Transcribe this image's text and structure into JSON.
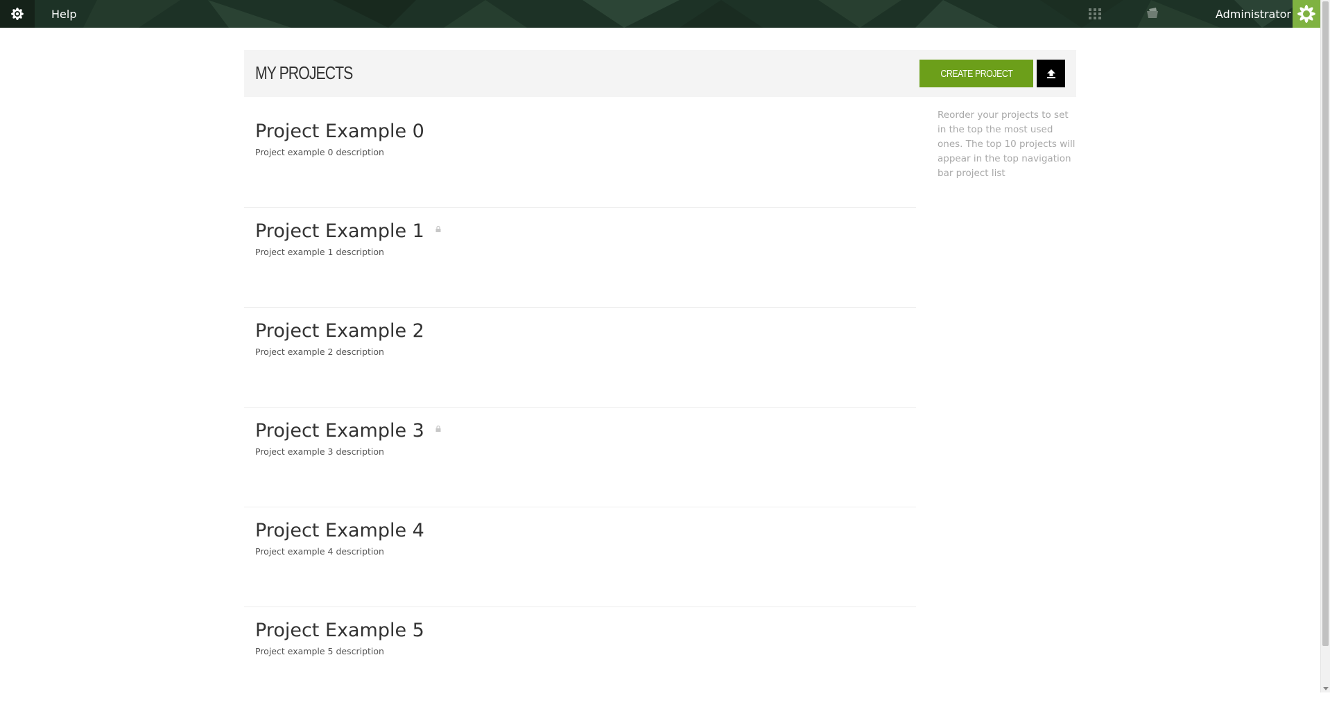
{
  "topbar": {
    "help_label": "Help",
    "user_name": "Administrator",
    "icons": [
      "logo-icon",
      "apps-grid-icon",
      "inbox-icon",
      "avatar-icon"
    ],
    "background_color": "#1d3226"
  },
  "header": {
    "title": "MY PROJECTS",
    "create_label": "CREATE PROJECT",
    "upload_icon": "upload-icon",
    "accent_color": "#6c9f1a"
  },
  "hint": {
    "text": "Reorder your projects to set in the top the most used ones. The top 10 projects will appear in the top navigation bar project list"
  },
  "projects": [
    {
      "name": "Project Example 0",
      "description": "Project example 0 description",
      "private": false
    },
    {
      "name": "Project Example 1",
      "description": "Project example 1 description",
      "private": true
    },
    {
      "name": "Project Example 2",
      "description": "Project example 2 description",
      "private": false
    },
    {
      "name": "Project Example 3",
      "description": "Project example 3 description",
      "private": true
    },
    {
      "name": "Project Example 4",
      "description": "Project example 4 description",
      "private": false
    },
    {
      "name": "Project Example 5",
      "description": "Project example 5 description",
      "private": false
    }
  ]
}
